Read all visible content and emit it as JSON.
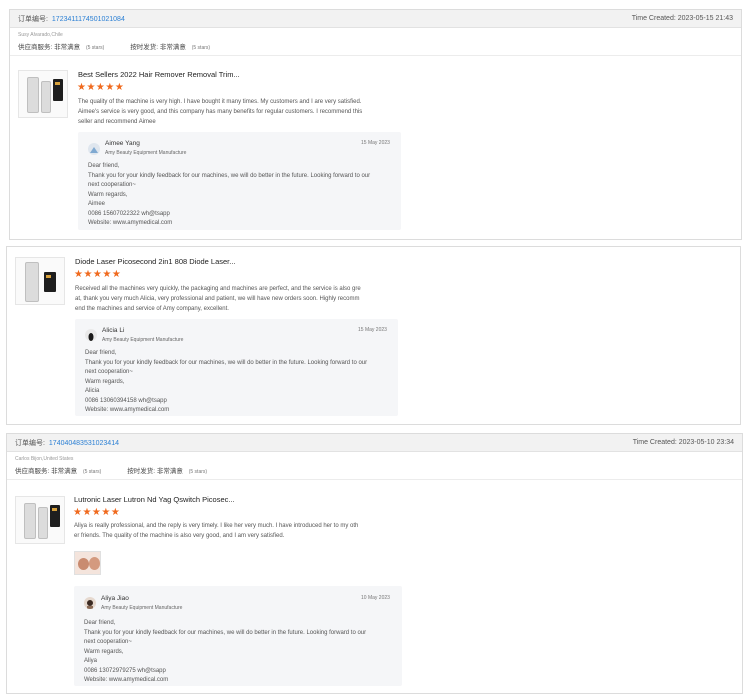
{
  "orders": [
    {
      "order_label": "订单编号",
      "order_number": "1723411174501021084",
      "time_created": "Time Created: 2023-05-15 21:43",
      "buyer_meta": "Susy Alvarado,Chile",
      "supplier_service_label": "供应商服务:",
      "supplier_service_value": "非常满意",
      "supplier_service_stars": "(5 stars)",
      "delivery_label": "按时发货:",
      "delivery_value": "非常满意",
      "delivery_stars": "(5 stars)"
    },
    {
      "order_label": "订单编号",
      "order_number": "174040483531023414",
      "time_created": "Time Created: 2023-05-10 23:34",
      "buyer_meta": "Carlos Bijon,United States",
      "supplier_service_label": "供应商服务:",
      "supplier_service_value": "非常满意",
      "supplier_service_stars": "(5 stars)",
      "delivery_label": "按时发货:",
      "delivery_value": "非常满意",
      "delivery_stars": "(5 stars)"
    }
  ],
  "reviews": [
    {
      "title": "Best Sellers 2022 Hair Remover Removal Trim...",
      "stars": "★★★★★",
      "rating": 5,
      "lines": [
        "The quality of the machine is very high. I have bought it many times. My customers and I are very satisfied.",
        "Aimee's service is very good, and this company has many benefits for regular customers. I recommend this",
        "seller and recommend Aimee"
      ],
      "reply": {
        "name": "Aimee Yang",
        "company": "Amy Beauty Equipment Manufacture",
        "date": "15 May 2023",
        "lines": [
          "Dear friend,",
          "Thank you for your kindly feedback for our machines, we will do better in the future. Looking forward to our",
          "next cooperation~",
          "Warm regards,",
          "Aimee",
          "0086 15607022322 wh@tsapp",
          "Website: www.amymedical.com"
        ]
      }
    },
    {
      "title": "Diode Laser Picosecond 2in1 808 Diode Laser...",
      "stars": "★★★★★",
      "rating": 5,
      "lines": [
        "Received all the machines very quickly, the packaging and machines are perfect, and the service is also gre",
        "at, thank you very much Alicia, very professional and patient, we will have new orders soon. Highly recomm",
        "end the machines and service of Amy company, excellent."
      ],
      "reply": {
        "name": "Alicia Li",
        "company": "Amy Beauty Equipment Manufacture",
        "date": "15 May 2023",
        "lines": [
          "Dear friend,",
          "Thank you for your kindly feedback for our machines, we will do better in the future. Looking forward to our",
          "next cooperation~",
          "Warm regards,",
          "Alicia",
          "0086 13060394158 wh@tsapp",
          "Website: www.amymedical.com"
        ]
      }
    },
    {
      "title": "Lutronic Laser Lutron Nd Yag Qswitch Picosec...",
      "stars": "★★★★★",
      "rating": 5,
      "lines": [
        "Aliya is really professional, and the reply is very timely. I like her very much. I have introduced her to my oth",
        "er friends. The quality of the machine is also very good, and I am very satisfied."
      ],
      "reply": {
        "name": "Aliya Jiao",
        "company": "Amy Beauty Equipment Manufacture",
        "date": "10 May 2023",
        "lines": [
          "Dear friend,",
          "Thank you for your kindly feedback for our machines, we will do better in the future. Looking forward to our",
          "next cooperation~",
          "Warm regards,",
          "Aliya",
          "0086 13072979275 wh@tsapp",
          "Website: www.amymedical.com"
        ]
      }
    }
  ],
  "icons": {
    "star": "star-icon",
    "avatar": "avatar-icon"
  },
  "colors": {
    "star": "#f06a1e",
    "order_number": "#2a7fd4",
    "header_bg": "#f2f2f2",
    "reply_bg": "#f5f6f8"
  }
}
